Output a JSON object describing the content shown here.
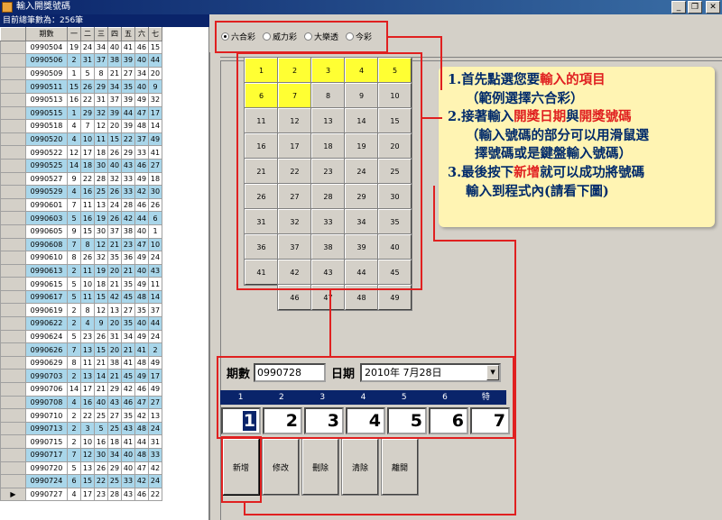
{
  "window": {
    "title": "輸入開獎號碼"
  },
  "records": {
    "count_label": "目前總筆數為：256筆",
    "columns": [
      "期數",
      "一",
      "二",
      "三",
      "四",
      "五",
      "六",
      "七"
    ],
    "rows": [
      [
        "0990504",
        "19",
        "24",
        "34",
        "40",
        "41",
        "46",
        "15"
      ],
      [
        "0990506",
        "2",
        "31",
        "37",
        "38",
        "39",
        "40",
        "44"
      ],
      [
        "0990509",
        "1",
        "5",
        "8",
        "21",
        "27",
        "34",
        "20"
      ],
      [
        "0990511",
        "15",
        "26",
        "29",
        "34",
        "35",
        "40",
        "9"
      ],
      [
        "0990513",
        "16",
        "22",
        "31",
        "37",
        "39",
        "49",
        "32"
      ],
      [
        "0990515",
        "1",
        "29",
        "32",
        "39",
        "44",
        "47",
        "17"
      ],
      [
        "0990518",
        "4",
        "7",
        "12",
        "20",
        "39",
        "48",
        "14"
      ],
      [
        "0990520",
        "4",
        "10",
        "11",
        "15",
        "22",
        "37",
        "49"
      ],
      [
        "0990522",
        "12",
        "17",
        "18",
        "26",
        "29",
        "33",
        "41"
      ],
      [
        "0990525",
        "14",
        "18",
        "30",
        "40",
        "43",
        "46",
        "27"
      ],
      [
        "0990527",
        "9",
        "22",
        "28",
        "32",
        "33",
        "49",
        "18"
      ],
      [
        "0990529",
        "4",
        "16",
        "25",
        "26",
        "33",
        "42",
        "30"
      ],
      [
        "0990601",
        "7",
        "11",
        "13",
        "24",
        "28",
        "46",
        "26"
      ],
      [
        "0990603",
        "5",
        "16",
        "19",
        "26",
        "42",
        "44",
        "6"
      ],
      [
        "0990605",
        "9",
        "15",
        "30",
        "37",
        "38",
        "40",
        "1"
      ],
      [
        "0990608",
        "7",
        "8",
        "12",
        "21",
        "23",
        "47",
        "10"
      ],
      [
        "0990610",
        "8",
        "26",
        "32",
        "35",
        "36",
        "49",
        "24"
      ],
      [
        "0990613",
        "2",
        "11",
        "19",
        "20",
        "21",
        "40",
        "43"
      ],
      [
        "0990615",
        "5",
        "10",
        "18",
        "21",
        "35",
        "49",
        "11"
      ],
      [
        "0990617",
        "5",
        "11",
        "15",
        "42",
        "45",
        "48",
        "14"
      ],
      [
        "0990619",
        "2",
        "8",
        "12",
        "13",
        "27",
        "35",
        "37"
      ],
      [
        "0990622",
        "2",
        "4",
        "9",
        "20",
        "35",
        "40",
        "44"
      ],
      [
        "0990624",
        "5",
        "23",
        "26",
        "31",
        "34",
        "49",
        "24"
      ],
      [
        "0990626",
        "7",
        "13",
        "15",
        "20",
        "21",
        "41",
        "2"
      ],
      [
        "0990629",
        "8",
        "11",
        "21",
        "38",
        "41",
        "48",
        "49"
      ],
      [
        "0990703",
        "2",
        "13",
        "14",
        "21",
        "45",
        "49",
        "17"
      ],
      [
        "0990706",
        "14",
        "17",
        "21",
        "29",
        "42",
        "46",
        "49"
      ],
      [
        "0990708",
        "4",
        "16",
        "40",
        "43",
        "46",
        "47",
        "27"
      ],
      [
        "0990710",
        "2",
        "22",
        "25",
        "27",
        "35",
        "42",
        "13"
      ],
      [
        "0990713",
        "2",
        "3",
        "5",
        "25",
        "43",
        "48",
        "24"
      ],
      [
        "0990715",
        "2",
        "10",
        "16",
        "18",
        "41",
        "44",
        "31"
      ],
      [
        "0990717",
        "7",
        "12",
        "30",
        "34",
        "40",
        "48",
        "33"
      ],
      [
        "0990720",
        "5",
        "13",
        "26",
        "29",
        "40",
        "47",
        "42"
      ],
      [
        "0990724",
        "6",
        "15",
        "22",
        "25",
        "33",
        "42",
        "24"
      ],
      [
        "0990727",
        "4",
        "17",
        "23",
        "28",
        "43",
        "46",
        "22"
      ]
    ],
    "current_row_marker": "▶"
  },
  "lottery_types": {
    "options": [
      "六合彩",
      "威力彩",
      "大樂透",
      "今彩"
    ],
    "selected": "六合彩"
  },
  "number_pad": {
    "numbers": [
      "1",
      "2",
      "3",
      "4",
      "5",
      "6",
      "7",
      "8",
      "9",
      "10",
      "11",
      "12",
      "13",
      "14",
      "15",
      "16",
      "17",
      "18",
      "19",
      "20",
      "21",
      "22",
      "23",
      "24",
      "25",
      "26",
      "27",
      "28",
      "29",
      "30",
      "31",
      "32",
      "33",
      "34",
      "35",
      "36",
      "37",
      "38",
      "39",
      "40",
      "41",
      "42",
      "43",
      "44",
      "45",
      "",
      "46",
      "47",
      "48",
      "49"
    ],
    "highlighted": [
      "1",
      "2",
      "3",
      "4",
      "5",
      "6",
      "7"
    ],
    "highlight_color": "#ffff33"
  },
  "instructions": {
    "line1_num": "1.",
    "line1_a": "首先點選您要",
    "line1_hl": "輸入的項目",
    "line2": "（範例選擇六合彩）",
    "line3_num": "2.",
    "line3_a": "接著輸入",
    "line3_hl1": "開獎日期",
    "line3_b": "與",
    "line3_hl2": "開獎號碼",
    "line4": "（輸入號碼的部分可以用滑鼠選",
    "line5": "擇號碼或是鍵盤輸入號碼）",
    "line6_num": "3.",
    "line6_a": "最後按下",
    "line6_hl": "新增",
    "line6_b": "就可以成功將號碼",
    "line7": "輸入到程式內(請看下圖)",
    "highlight_color": "#e02020",
    "text_color": "#002a6a"
  },
  "form": {
    "period_label": "期數",
    "period_value": "0990728",
    "date_label": "日期",
    "date_value": "2010年  7月28日",
    "dropdown_arrow": "▼"
  },
  "ball_inputs": {
    "headers": [
      "1",
      "2",
      "3",
      "4",
      "5",
      "6",
      "特"
    ],
    "values": [
      "1",
      "2",
      "3",
      "4",
      "5",
      "6",
      "7"
    ]
  },
  "actions": {
    "add": "新增",
    "edit": "修改",
    "delete": "刪除",
    "clear": "清除",
    "exit": "離開"
  },
  "window_buttons": {
    "minimize": "_",
    "restore": "❐",
    "close": "✕"
  },
  "accent_color": "#e02020"
}
